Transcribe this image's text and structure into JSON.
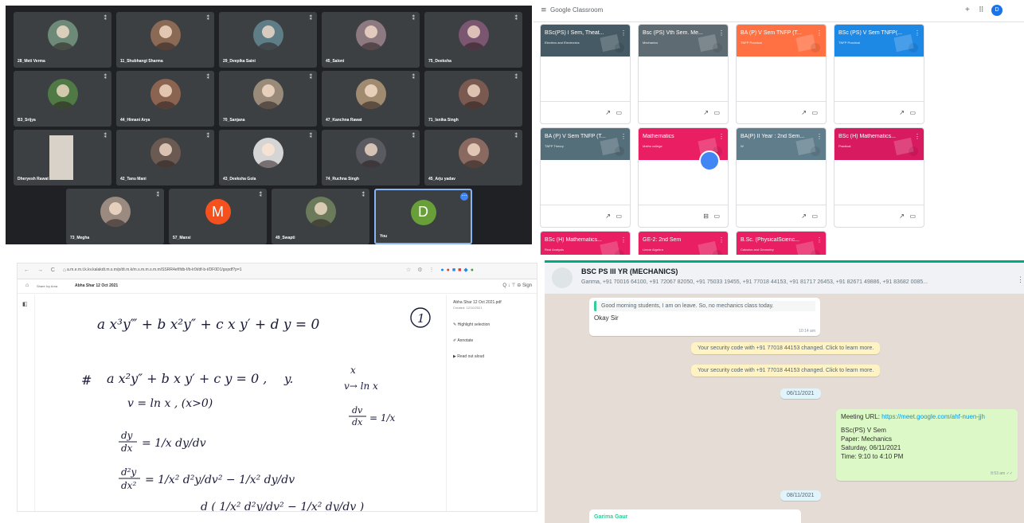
{
  "meet": {
    "participants": [
      {
        "name": "28_Meti Verma",
        "avatar_color": "#6d8a78"
      },
      {
        "name": "11_Shubhangi Sharma",
        "avatar_color": "#8a6a55"
      },
      {
        "name": "29_Deepika Saini",
        "avatar_color": "#5f7d86"
      },
      {
        "name": "45_Saloni",
        "avatar_color": "#8c7a80"
      },
      {
        "name": "75_Deeksha",
        "avatar_color": "#7a5670"
      },
      {
        "name": "B3_Srijya",
        "avatar_color": "#4f7a45"
      },
      {
        "name": "44_Himani Arya",
        "avatar_color": "#8a6450"
      },
      {
        "name": "70_Sanjana",
        "avatar_color": "#9a8a7a"
      },
      {
        "name": "47_Kanchna Rawat",
        "avatar_color": "#a08a70"
      },
      {
        "name": "71_Isnika Singh",
        "avatar_color": "#7a5a50"
      },
      {
        "name": "Dheryesh Rawat",
        "avatar_color": "#d8d2c8"
      },
      {
        "name": "42_Tanu Mani",
        "avatar_color": "#6a5a52"
      },
      {
        "name": "43_Deeksha Gola",
        "avatar_color": "#d5d5d5"
      },
      {
        "name": "74_Ruchna Singh",
        "avatar_color": "#5a5a60"
      },
      {
        "name": "45_Arju yadav",
        "avatar_color": "#8a6a60"
      },
      {
        "name": "73_Megha",
        "avatar_color": "#9a8a80"
      },
      {
        "name": "57_Mansi",
        "avatar_letter": "M",
        "avatar_color": "#f4511e"
      },
      {
        "name": "49_Swapti",
        "avatar_color": "#6a7a5a"
      },
      {
        "name": "You",
        "avatar_letter": "D",
        "avatar_color": "#689f38"
      }
    ]
  },
  "classroom": {
    "menu_icon": "hamburger-icon",
    "title": "Google Classroom",
    "plus": "+",
    "apps": "⠿",
    "account_initial": "D",
    "cards": [
      {
        "title": "BSc(PS) I Sem, Theat...",
        "subtitle": "Electrics and Electronics",
        "color": "#455a64"
      },
      {
        "title": "Bsc (PS) Vth Sem. Me...",
        "subtitle": "Mechanics",
        "color": "#5f6b73"
      },
      {
        "title": "BA (P) V Sem TNFP (T...",
        "subtitle": "TNFP Practical",
        "color": "#ff7043"
      },
      {
        "title": "BSc (PS) V Sem TNFP(...",
        "subtitle": "TNFP Practical",
        "color": "#1e88e5"
      },
      {
        "title": "BA (P) V Sem TNFP (T...",
        "subtitle": "TNFP Theory",
        "color": "#546e7a"
      },
      {
        "title": "Mathematics",
        "subtitle": "Maths college",
        "color": "#e91e63"
      },
      {
        "title": "BA(P) II Year : 2nd Sem...",
        "subtitle": "W",
        "color": "#607d8b"
      },
      {
        "title": "BSc (H) Mathematics...",
        "subtitle": "Practical",
        "color": "#d81b60"
      },
      {
        "title": "BSc (H) Mathematics...",
        "subtitle": "Real Analysis",
        "color": "#e91e63"
      },
      {
        "title": "GE-2: 2nd Sem",
        "subtitle": "Linear Algebra",
        "color": "#e91e63"
      },
      {
        "title": "B.Sc. (PhysicalScienc...",
        "subtitle": "Calculus and Geometry",
        "color": "#e91e63"
      }
    ]
  },
  "pdf": {
    "nav": "← → C ⌂",
    "url": "a.m.e.m.t.k.kv.kalakdt.m.s.m/p/dt.m.k/m.s.m.m.s.m.m/SSRR4ef/fdb-f/b-lr0t/df-b-t/DF0D1/gopdf?p=1",
    "tab_crumb": "Share Ivy Arna",
    "tab_doc": "Abha Shar 12 Oct 2021",
    "right_toolbar": "Q  ↓  ⊤  ⊖ Sign",
    "file_name": "Abha Shar 12 Oct 2021.pdf",
    "file_sub": "Created: 12/10/2021",
    "actions": [
      "Highlight selection",
      "Annotate",
      "Read out aloud"
    ],
    "page_number": "1"
  },
  "whatsapp": {
    "group_name": "BSC PS III YR (MECHANICS)",
    "members": "Garima, +91 70016 64100, +91 72067 82050, +91 75033 19455, +91 77018 44153, +91 81717 26453, +91 82671 49886, +91 83682 0085...",
    "more_icon": "⋮",
    "messages": [
      {
        "type": "in",
        "quote": "Good morning students, I am on leave. So, no mechanics class today.",
        "text": "Okay Sir",
        "time": "10:14 am"
      },
      {
        "type": "sys",
        "text": "Your security code with +91 77018 44153 changed. Click to learn more."
      },
      {
        "type": "sys",
        "text": "Your security code with +91 77018 44153 changed. Click to learn more."
      },
      {
        "type": "date",
        "text": "06/11/2021"
      },
      {
        "type": "out",
        "label": "Meeting URL:",
        "link": "https://meet.google.com/ahf-nuen-jjh",
        "lines": [
          "BSc(PS) V Sem",
          "Paper: Mechanics",
          "Saturday, 06/11/2021",
          "Time: 9:10 to 4:10 PM"
        ],
        "time": "8:53 am ✓✓"
      },
      {
        "type": "date",
        "text": "08/11/2021"
      },
      {
        "type": "in",
        "sender": "Garima Gaur"
      }
    ]
  }
}
